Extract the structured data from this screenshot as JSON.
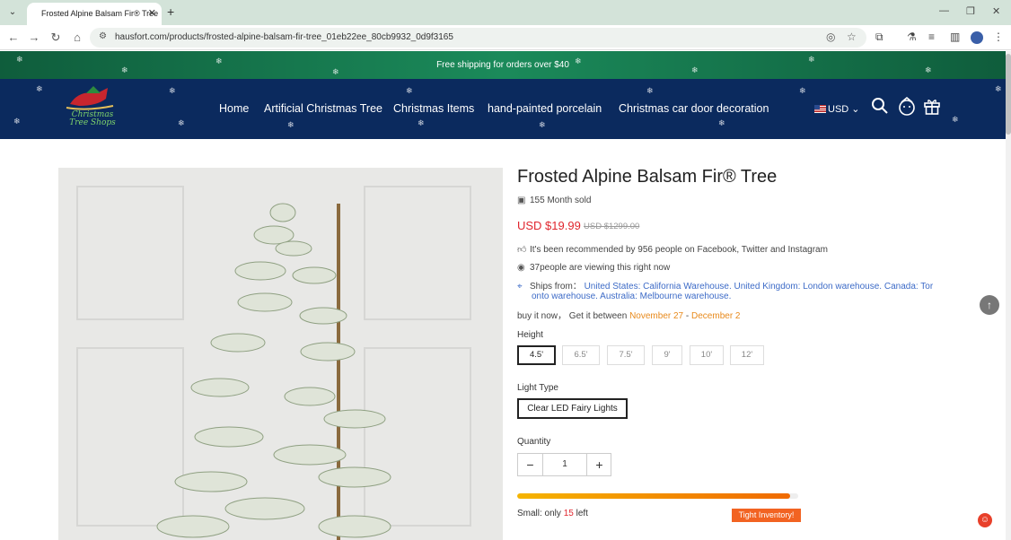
{
  "browser": {
    "tab_title": "Frosted Alpine Balsam Fir® Tree",
    "url": "hausfort.com/products/frosted-alpine-balsam-fir-tree_01eb22ee_80cb9932_0d9f3165"
  },
  "announcement": "Free shipping for orders over $40",
  "header": {
    "logo_text": "Christmas Tree Shops",
    "nav": [
      "Home",
      "Artificial Christmas Tree",
      "Christmas Items",
      "hand-painted porcelain",
      "Christmas car door decoration"
    ],
    "currency": "USD"
  },
  "product": {
    "title": "Frosted Alpine Balsam Fir® Tree",
    "sold": "155 Month sold",
    "price": "USD $19.99",
    "old_price": "USD $1299.00",
    "recommend": "It's been recommended by 956 people on Facebook, Twitter and Instagram",
    "viewing": "37people are viewing this right now",
    "ships_label": "Ships from：",
    "ships_from_1": "United States: California Warehouse. United Kingdom: London warehouse. Canada: Tor",
    "ships_from_2": "onto warehouse. Australia: Melbourne warehouse.",
    "delivery_prefix": "buy it now，  Get it between",
    "date_start": "November 27",
    "date_sep": "-",
    "date_end": "December 2",
    "height_label": "Height",
    "heights": [
      "4.5'",
      "6.5'",
      "7.5'",
      "9'",
      "10'",
      "12'"
    ],
    "light_label": "Light Type",
    "light_option": "Clear LED Fairy Lights",
    "quantity_label": "Quantity",
    "quantity": "1",
    "stock_prefix": "Small: only",
    "stock_count": "15",
    "stock_suffix": "left",
    "stock_level": 0.97,
    "tight_badge": "Tight Inventory!"
  },
  "colors": {
    "accent": "#e0262e",
    "header_bg": "#0b2a5e",
    "announcement_bg": "#1b8a5a"
  }
}
